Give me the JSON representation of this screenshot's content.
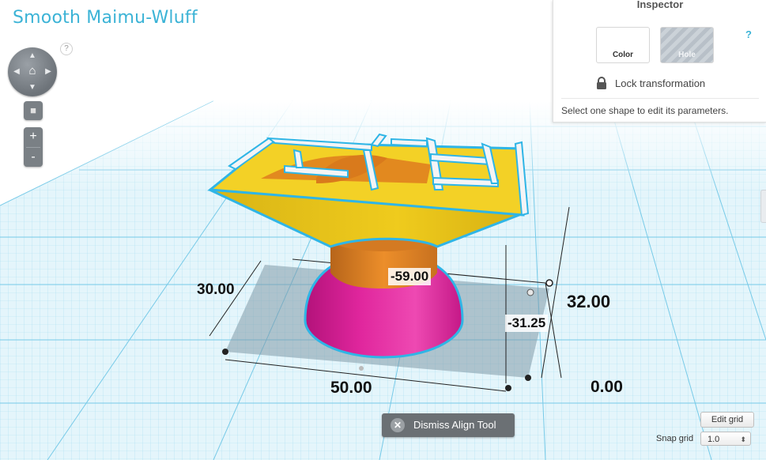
{
  "app": {
    "title": "Smooth Maimu-Wluff",
    "help": "?"
  },
  "view_controls": {
    "icons": [
      "nav-up-icon",
      "nav-down-icon",
      "nav-left-icon",
      "nav-right-icon",
      "home-icon",
      "view-cube-icon"
    ],
    "zoom_in": "+",
    "zoom_out": "-"
  },
  "inspector": {
    "title": "Inspector",
    "help": "?",
    "color_label": "Color",
    "hole_label": "Hole",
    "lock_label": "Lock transformation",
    "status": "Select one shape to edit its parameters."
  },
  "dimensions": {
    "width": "50.00",
    "depth": "30.00",
    "height": "32.00",
    "elevation": "0.00",
    "x_offset": "-59.00",
    "y_offset": "-31.25"
  },
  "align_tool": {
    "dismiss_label": "Dismiss Align Tool"
  },
  "grid": {
    "edit_label": "Edit grid",
    "snap_label": "Snap grid",
    "snap_value": "1.0"
  },
  "colors": {
    "grid_line": "#8fd3ea",
    "grid_bg": "#e4f5fb",
    "yellow": "#f5d21f",
    "orange": "#e98a23",
    "magenta": "#e0269d",
    "outline": "#2fb5e6",
    "accent": "#3bb3d6"
  }
}
